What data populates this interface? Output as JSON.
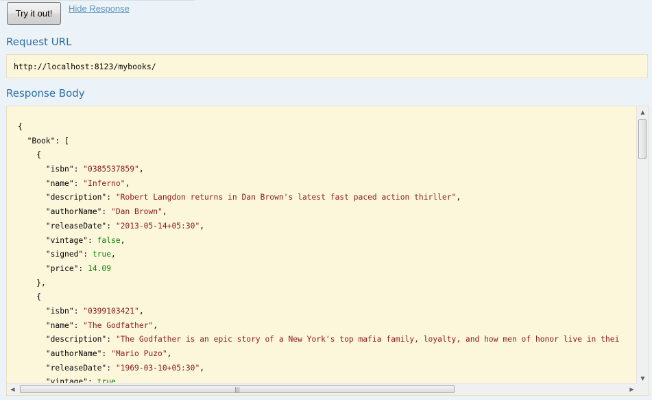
{
  "actions": {
    "try_label": "Try it out!",
    "hide_label": "Hide Response"
  },
  "request": {
    "title": "Request URL",
    "url": "http://localhost:8123/mybooks/"
  },
  "response": {
    "title": "Response Body",
    "lines": [
      [
        {
          "t": "{",
          "c": "k"
        }
      ],
      [
        {
          "t": "  \"Book\": [",
          "c": "k"
        }
      ],
      [
        {
          "t": "    {",
          "c": "k"
        }
      ],
      [
        {
          "t": "      \"isbn\": ",
          "c": "k"
        },
        {
          "t": "\"0385537859\"",
          "c": "s"
        },
        {
          "t": ",",
          "c": "k"
        }
      ],
      [
        {
          "t": "      \"name\": ",
          "c": "k"
        },
        {
          "t": "\"Inferno\"",
          "c": "s"
        },
        {
          "t": ",",
          "c": "k"
        }
      ],
      [
        {
          "t": "      \"description\": ",
          "c": "k"
        },
        {
          "t": "\"Robert Langdon returns in Dan Brown's latest fast paced action thirller\"",
          "c": "s"
        },
        {
          "t": ",",
          "c": "k"
        }
      ],
      [
        {
          "t": "      \"authorName\": ",
          "c": "k"
        },
        {
          "t": "\"Dan Brown\"",
          "c": "s"
        },
        {
          "t": ",",
          "c": "k"
        }
      ],
      [
        {
          "t": "      \"releaseDate\": ",
          "c": "k"
        },
        {
          "t": "\"2013-05-14+05:30\"",
          "c": "s"
        },
        {
          "t": ",",
          "c": "k"
        }
      ],
      [
        {
          "t": "      \"vintage\": ",
          "c": "k"
        },
        {
          "t": "false",
          "c": "b"
        },
        {
          "t": ",",
          "c": "k"
        }
      ],
      [
        {
          "t": "      \"signed\": ",
          "c": "k"
        },
        {
          "t": "true",
          "c": "b"
        },
        {
          "t": ",",
          "c": "k"
        }
      ],
      [
        {
          "t": "      \"price\": ",
          "c": "k"
        },
        {
          "t": "14.09",
          "c": "n"
        }
      ],
      [
        {
          "t": "    },",
          "c": "k"
        }
      ],
      [
        {
          "t": "    {",
          "c": "k"
        }
      ],
      [
        {
          "t": "      \"isbn\": ",
          "c": "k"
        },
        {
          "t": "\"0399103421\"",
          "c": "s"
        },
        {
          "t": ",",
          "c": "k"
        }
      ],
      [
        {
          "t": "      \"name\": ",
          "c": "k"
        },
        {
          "t": "\"The Godfather\"",
          "c": "s"
        },
        {
          "t": ",",
          "c": "k"
        }
      ],
      [
        {
          "t": "      \"description\": ",
          "c": "k"
        },
        {
          "t": "\"The Godfather is an epic story of a New York's top mafia family, loyalty, and how men of honor live in thei",
          "c": "s"
        }
      ],
      [
        {
          "t": "      \"authorName\": ",
          "c": "k"
        },
        {
          "t": "\"Mario Puzo\"",
          "c": "s"
        },
        {
          "t": ",",
          "c": "k"
        }
      ],
      [
        {
          "t": "      \"releaseDate\": ",
          "c": "k"
        },
        {
          "t": "\"1969-03-10+05:30\"",
          "c": "s"
        },
        {
          "t": ",",
          "c": "k"
        }
      ],
      [
        {
          "t": "      \"vintage\": ",
          "c": "k"
        },
        {
          "t": "true",
          "c": "b"
        },
        {
          "t": ",",
          "c": "k"
        }
      ]
    ]
  },
  "scrollbars": {
    "up_arrow": "▲",
    "down_arrow": "▼",
    "left_arrow": "◀",
    "right_arrow": "▶",
    "grip": "|||"
  },
  "colors": {
    "background": "#ebf3f9",
    "title": "#2b6ea3",
    "link": "#5e93bd",
    "code_bg": "#fcf6db",
    "string": "#8b1a1a",
    "literal": "#0a8a0a"
  }
}
